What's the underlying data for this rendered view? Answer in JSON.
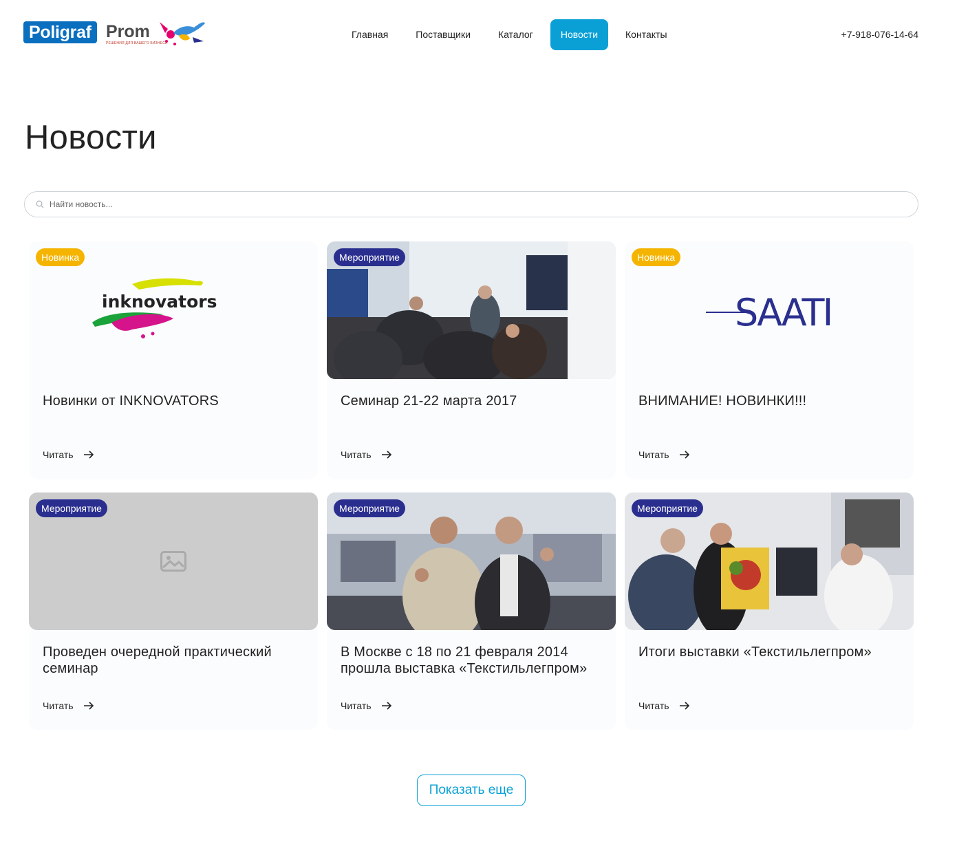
{
  "brand": {
    "part1": "Poligraf",
    "part2": "Prom",
    "tagline": "РЕШЕНИЯ ДЛЯ ВАШЕГО БИЗНЕСА"
  },
  "nav": [
    {
      "label": "Главная",
      "active": false
    },
    {
      "label": "Поставщики",
      "active": false
    },
    {
      "label": "Каталог",
      "active": false
    },
    {
      "label": "Новости",
      "active": true
    },
    {
      "label": "Контакты",
      "active": false
    }
  ],
  "phone": "+7-918-076-14-64",
  "page_title": "Новости",
  "search": {
    "placeholder": "Найти новость...",
    "value": "",
    "icon": "search-icon"
  },
  "cards": [
    {
      "badge": "Новинка",
      "badge_type": "new",
      "title": "Новинки от INKNOVATORS",
      "read": "Читать",
      "image": "inknovators-logo",
      "logo_text": "inknovators"
    },
    {
      "badge": "Мероприятие",
      "badge_type": "event",
      "title": "Семинар 21-22 марта 2017",
      "read": "Читать",
      "image": "seminar-photo"
    },
    {
      "badge": "Новинка",
      "badge_type": "new",
      "title": "ВНИМАНИЕ! НОВИНКИ!!!",
      "read": "Читать",
      "image": "saati-logo",
      "logo_text": "SAATI"
    },
    {
      "badge": "Мероприятие",
      "badge_type": "event",
      "title": "Проведен очередной практический семинар",
      "read": "Читать",
      "image": "image-placeholder-icon"
    },
    {
      "badge": "Мероприятие",
      "badge_type": "event",
      "title": "В Москве с 18 по 21 февраля 2014 прошла выставка «Текстильлегпром»",
      "read": "Читать",
      "image": "exhibition-photo"
    },
    {
      "badge": "Мероприятие",
      "badge_type": "event",
      "title": "Итоги выставки «Текстильлегпром»",
      "read": "Читать",
      "image": "exhibition-results-photo"
    }
  ],
  "show_more": "Показать еще",
  "colors": {
    "accent": "#0aa0d6",
    "badge_new": "#f5b400",
    "badge_event": "#2a2f8f",
    "logo_blue": "#0a6fbf"
  }
}
